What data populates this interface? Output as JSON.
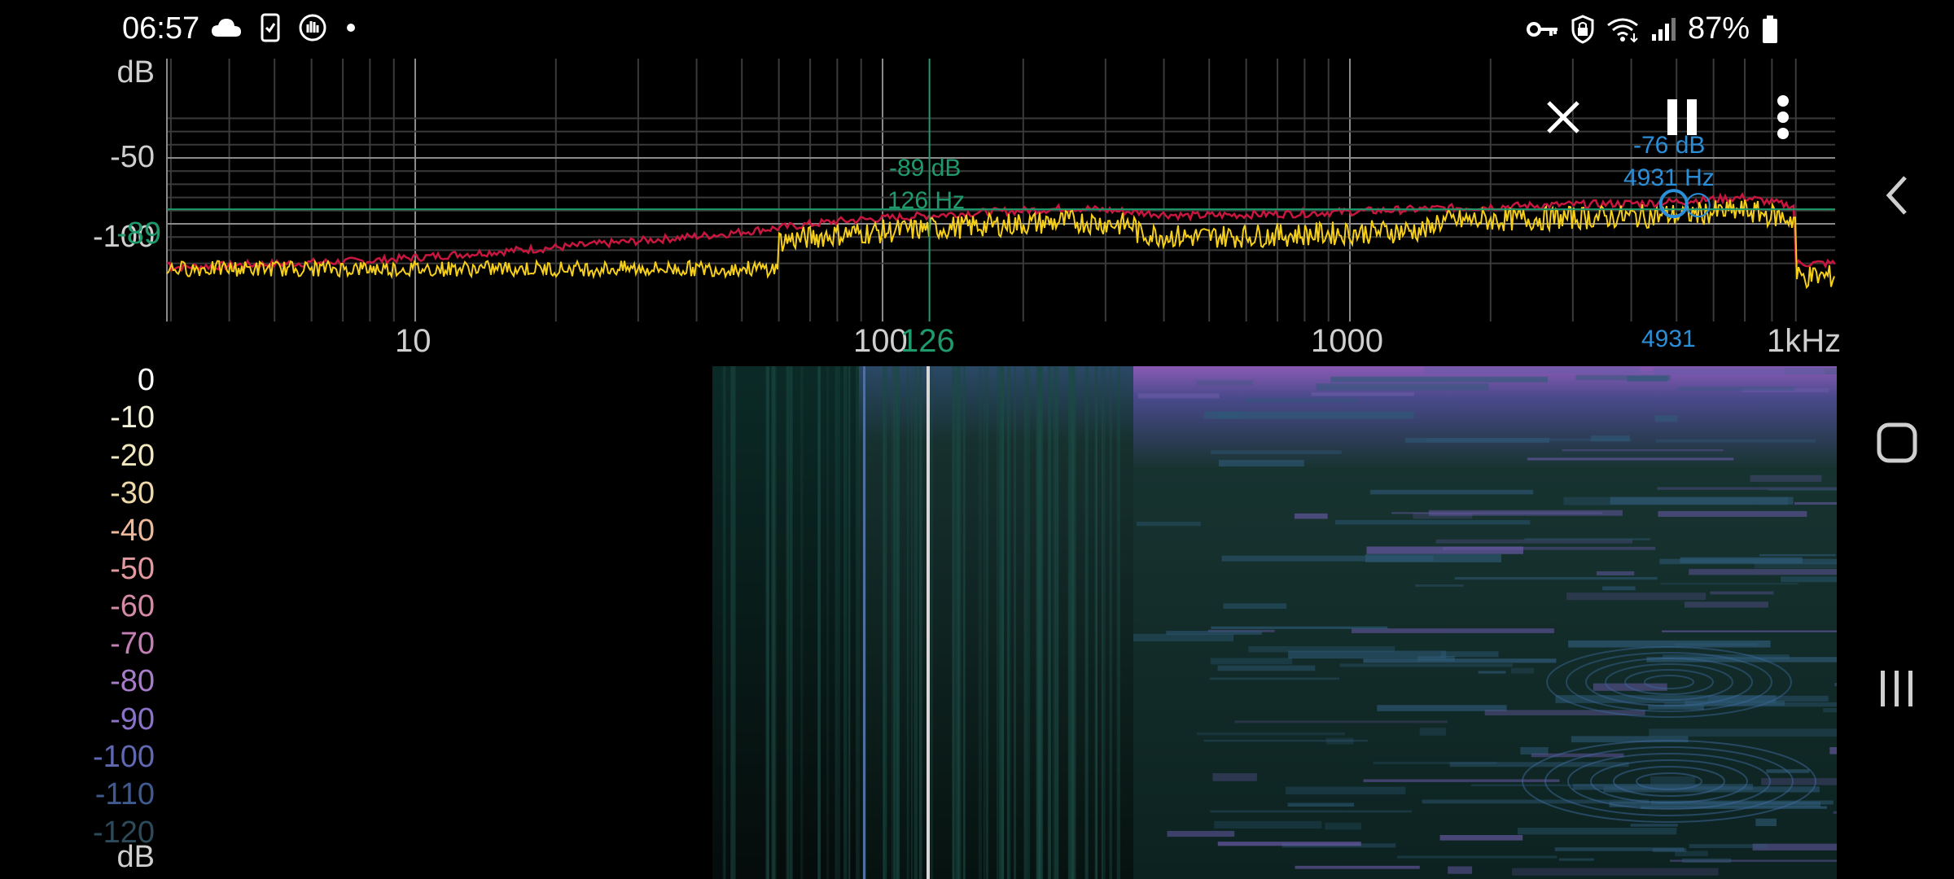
{
  "status_bar": {
    "time": "06:57",
    "battery": "87%",
    "left_icons": [
      "cloud-icon",
      "phone-check-icon",
      "hand-badge-icon",
      "dot-icon"
    ],
    "right_icons": [
      "key-icon",
      "lock-badge-icon",
      "wifi-icon",
      "signal-icon",
      "battery-icon"
    ]
  },
  "spectrum": {
    "db_unit": "dB",
    "db_ticks": [
      "-50",
      "-89",
      "-100"
    ],
    "freq_ticks": [
      "10",
      "100",
      "1000",
      "1kHz"
    ],
    "cursor": {
      "db_label": "-89 dB",
      "hz_label": "126 Hz",
      "axis_db": "-89",
      "axis_hz": "126",
      "color": "#1f9a6c"
    },
    "peak": {
      "db_label": "-76 dB",
      "hz_label": "4931 Hz",
      "axis_hz": "4931",
      "color": "#2a8ed8"
    },
    "series_colors": {
      "peak_hold": "#c8163e",
      "live": "#f5cf1a"
    }
  },
  "toolbar": {
    "close_icon": "close-icon",
    "pause_icon": "pause-icon",
    "menu_icon": "more-vert-icon"
  },
  "spectrogram": {
    "db_unit": "dB",
    "db_ticks": [
      "0",
      "-10",
      "-20",
      "-30",
      "-40",
      "-50",
      "-60",
      "-70",
      "-80",
      "-90",
      "-100",
      "-110",
      "-120"
    ],
    "tick_colors": [
      "#ffffff",
      "#f4f2d8",
      "#f2e8c0",
      "#f0d9a8",
      "#eeb89a",
      "#e29aa0",
      "#d58aa8",
      "#c480b6",
      "#a77cc8",
      "#8a72c8",
      "#5f68b0",
      "#3f5a8e",
      "#2c4a5a"
    ]
  },
  "nav": {
    "back": "back-icon",
    "home": "home-icon",
    "recents": "recents-icon"
  }
}
